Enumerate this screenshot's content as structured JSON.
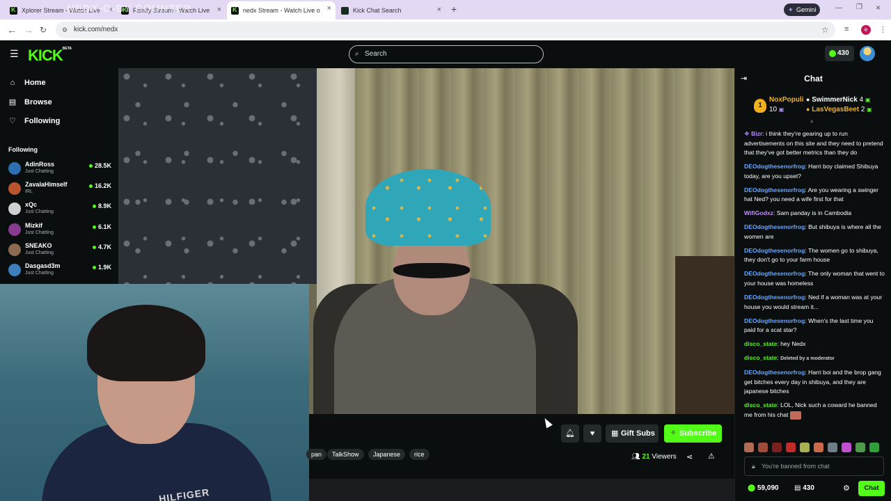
{
  "browser": {
    "tabs": [
      {
        "title": "Xplorer Stream - Watch Live"
      },
      {
        "title": "Family Stream - Watch Live"
      },
      {
        "title": "nedx Stream - Watch Live o"
      },
      {
        "title": "Kick Chat Search"
      }
    ],
    "overlay_text": "NEDX-O-BY COUNTER",
    "gemini_label": "Gemini",
    "url": "kick.com/nedx",
    "profile_initial": "e"
  },
  "header": {
    "logo": "KICK",
    "logo_badge": "BETA",
    "search_placeholder": "Search",
    "points": "430"
  },
  "sidebar": {
    "nav": [
      {
        "label": "Home",
        "icon": "home-icon"
      },
      {
        "label": "Browse",
        "icon": "browse-icon"
      },
      {
        "label": "Following",
        "icon": "heart-icon"
      }
    ],
    "following_title": "Following",
    "following": [
      {
        "name": "AdinRoss",
        "category": "Just Chatting",
        "viewers": "28.5K",
        "color": "#2e6fb0"
      },
      {
        "name": "ZavalaHimself",
        "category": "IRL",
        "viewers": "16.2K",
        "color": "#b8542f"
      },
      {
        "name": "xQc",
        "category": "Just Chatting",
        "viewers": "8.9K",
        "color": "#d0d0d0"
      },
      {
        "name": "Mizkif",
        "category": "Just Chatting",
        "viewers": "6.1K",
        "color": "#8a3b8f"
      },
      {
        "name": "SNEAKO",
        "category": "Just Chatting",
        "viewers": "4.7K",
        "color": "#8c6a4f"
      },
      {
        "name": "Dasgasd3m",
        "category": "Just Chatting",
        "viewers": "1.9K",
        "color": "#3d7fbd"
      }
    ]
  },
  "webcam": {
    "shirt_text": "HILFIGER"
  },
  "below_video": {
    "gift_subs": "Gift Subs",
    "subscribe": "Subscribe",
    "tags": [
      "pan",
      "TalkShow",
      "Japanese",
      "rice"
    ],
    "viewers_count": "21",
    "viewers_label": "Viewers"
  },
  "chat": {
    "title": "Chat",
    "leaderboard": [
      {
        "rank": "1",
        "name": "NoxPopuli",
        "count": "10",
        "color": "#f2b01e"
      },
      {
        "name": "SwimmerNick",
        "count": "4",
        "color": "#ffffff"
      },
      {
        "name": "LasVegasBeet",
        "count": "2",
        "color": "#f2b01e"
      }
    ],
    "messages": [
      {
        "user": "Bizr",
        "color": "#b48cff",
        "text": "i think they're gearing up to run advertisements on this site and they need to pretend that they've got better metrics than they do"
      },
      {
        "user": "DEOdogthesenorfrog",
        "color": "#6aa8ff",
        "text": "Harri boy claimed Shibuya today, are you upset?"
      },
      {
        "user": "DEOdogthesenorfrog",
        "color": "#6aa8ff",
        "text": "Are you wearing a swinger hat Ned? you need a wife first for that"
      },
      {
        "user": "WifiGodxz",
        "color": "#c78cff",
        "text": "Sam panday is in Cambodia"
      },
      {
        "user": "DEOdogthesenorfrog",
        "color": "#6aa8ff",
        "text": "But shibuya is where all the women are"
      },
      {
        "user": "DEOdogthesenorfrog",
        "color": "#6aa8ff",
        "text": "The women go to shibuya, they don't go to your farm house"
      },
      {
        "user": "DEOdogthesenorfrog",
        "color": "#6aa8ff",
        "text": "The only woman that went to your house was homeless"
      },
      {
        "user": "DEOdogthesenorfrog",
        "color": "#6aa8ff",
        "text": "Ned if a woman was at your house you would stream it..."
      },
      {
        "user": "DEOdogthesenorfrog",
        "color": "#6aa8ff",
        "text": "When's the last time you paid for a scat star?"
      },
      {
        "user": "disco_state",
        "color": "#53fc18",
        "text": "hey Nedx"
      },
      {
        "user": "disco_state",
        "color": "#53fc18",
        "text": "Deleted by a moderator",
        "deleted": true
      },
      {
        "user": "DEOdogthesenorfrog",
        "color": "#6aa8ff",
        "text": "Harri boi and the brop gang get bitches every day in shibuya, and they are japanese bitches"
      },
      {
        "user": "disco_state",
        "color": "#53fc18",
        "text": "LOL, Nick such a coward he banned me from his chat"
      }
    ],
    "banned_text": "You're banned from chat",
    "kick_points": "59,090",
    "subs_count": "430",
    "chat_button": "Chat"
  }
}
